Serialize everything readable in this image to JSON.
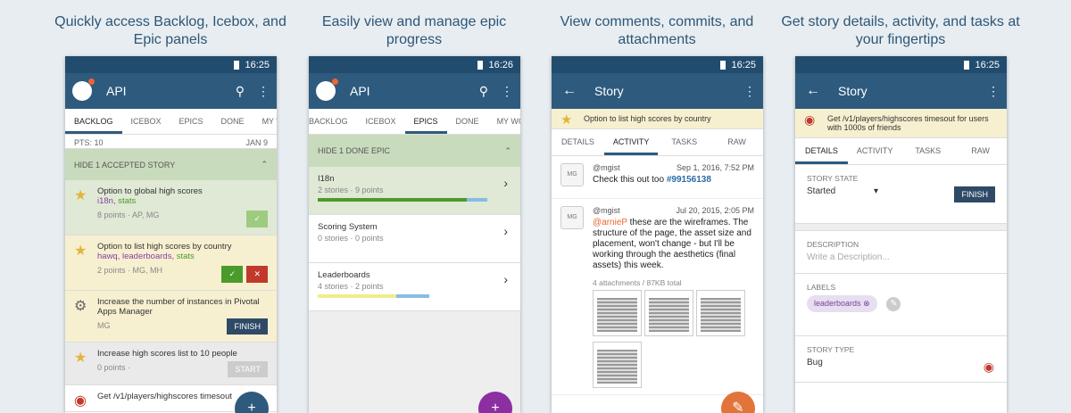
{
  "captions": [
    "Quickly access Backlog, Icebox, and Epic panels",
    "Easily view and manage epic progress",
    "View comments, commits, and attachments",
    "Get story details, activity, and tasks at your fingertips"
  ],
  "phone1": {
    "time": "16:25",
    "title": "API",
    "tabs": [
      "BACKLOG",
      "ICEBOX",
      "EPICS",
      "DONE",
      "MY WO"
    ],
    "pts": "PTS: 10",
    "date": "JAN 9",
    "banner": "HIDE 1 ACCEPTED STORY",
    "stories": [
      {
        "title": "Option to global high scores",
        "label1": "i18n",
        "label2": "stats",
        "meta": "8 points · AP, MG",
        "btn": "✓"
      },
      {
        "title": "Option to list high scores by country",
        "label1": "hawq, leaderboards",
        "label2": "stats",
        "meta": "2 points · MG, MH"
      },
      {
        "title": "Increase the number of instances in Pivotal Apps Manager",
        "meta": "MG",
        "btn": "FINISH"
      },
      {
        "title": "Increase high scores list to 10 people",
        "meta": "0 points ·",
        "btn": "START"
      },
      {
        "title": "Get /v1/players/highscores timesout"
      }
    ]
  },
  "phone2": {
    "time": "16:26",
    "title": "API",
    "tabs": [
      "BACKLOG",
      "ICEBOX",
      "EPICS",
      "DONE",
      "MY WORK"
    ],
    "banner": "HIDE 1 DONE EPIC",
    "epics": [
      {
        "name": "I18n",
        "sub": "2 stories · 9 points",
        "progress": 0.88
      },
      {
        "name": "Scoring System",
        "sub": "0 stories · 0 points"
      },
      {
        "name": "Leaderboards",
        "sub": "4 stories · 2 points",
        "progress": 0.7
      }
    ]
  },
  "phone3": {
    "time": "16:25",
    "title": "Story",
    "story": "Option to list high scores by country",
    "tabs": [
      "DETAILS",
      "ACTIVITY",
      "TASKS",
      "RAW"
    ],
    "comments": [
      {
        "avatar": "MG",
        "user": "@mgist",
        "date": "Sep 1, 2016, 7:52 PM",
        "text": "Check this out too ",
        "link": "#99156138"
      },
      {
        "avatar": "MG",
        "user": "@mgist",
        "date": "Jul 20, 2015, 2:05 PM",
        "mention": "@arnieP",
        "text": " these are the wireframes. The structure of the page, the asset size and placement, won't change - but I'll be working through the aesthetics (final assets) this week."
      }
    ],
    "attachments": "4 attachments / 87KB total"
  },
  "phone4": {
    "time": "16:25",
    "title": "Story",
    "story": "Get /v1/players/highscores timesout for users with 1000s of friends",
    "tabs": [
      "DETAILS",
      "ACTIVITY",
      "TASKS",
      "RAW"
    ],
    "state_label": "STORY STATE",
    "state": "Started",
    "finish": "FINISH",
    "desc_label": "DESCRIPTION",
    "desc_placeholder": "Write a Description...",
    "labels_label": "LABELS",
    "label": "leaderboards",
    "type_label": "STORY TYPE",
    "type": "Bug"
  },
  "colors": {
    "primary": "#2e5a7e",
    "accent": "#ef6432",
    "fab_purple": "#8b2fa3",
    "fab_orange": "#e2743b"
  }
}
